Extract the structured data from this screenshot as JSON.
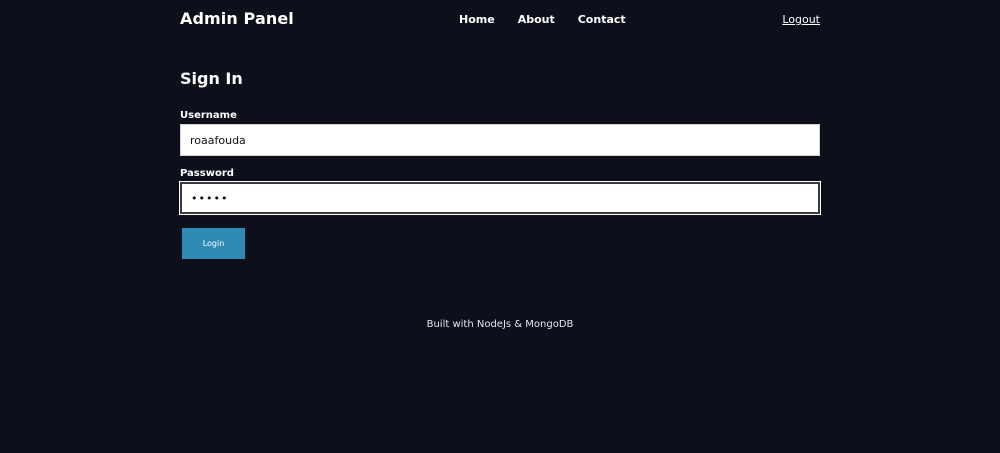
{
  "header": {
    "brand": "Admin Panel",
    "nav": [
      {
        "label": "Home"
      },
      {
        "label": "About"
      },
      {
        "label": "Contact"
      }
    ],
    "logout_label": "Logout"
  },
  "main": {
    "title": "Sign In",
    "username_label": "Username",
    "username_value": "roaafouda",
    "password_label": "Password",
    "password_value": "•••••",
    "login_label": "Login"
  },
  "footer": {
    "text": "Built with NodeJs & MongoDB"
  },
  "colors": {
    "background": "#0d0f1a",
    "button": "#2e8bb6",
    "text": "#ffffff"
  }
}
